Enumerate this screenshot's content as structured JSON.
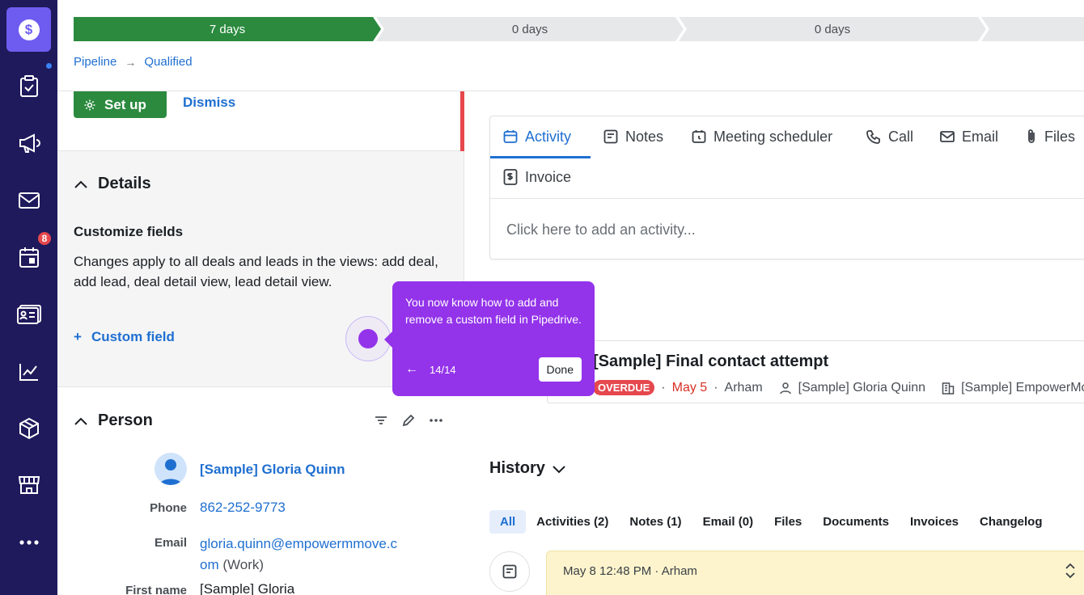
{
  "sidebar": {
    "logo_symbol": "$",
    "calendar_badge": "8",
    "items": [
      "tasks-icon",
      "megaphone-icon",
      "mail-icon",
      "calendar-icon",
      "contacts-icon",
      "chart-icon",
      "box-icon",
      "store-icon",
      "more-icon"
    ]
  },
  "stages": [
    "7 days",
    "0 days",
    "0 days"
  ],
  "breadcrumb": {
    "pipeline": "Pipeline",
    "arrow": "→",
    "stage": "Qualified"
  },
  "setup": {
    "setup_label": "Set up",
    "dismiss_label": "Dismiss"
  },
  "details": {
    "title": "Details",
    "customize_title": "Customize fields",
    "customize_text": "Changes apply to all deals and leads in the views: add deal, add lead, deal detail view, lead detail view.",
    "add_field": "Custom field",
    "plus": "+"
  },
  "person": {
    "title": "Person",
    "name": "[Sample] Gloria Quinn",
    "phone_label": "Phone",
    "phone": "862-252-9773",
    "email_label": "Email",
    "email_line1": "gloria.quinn@empowermmove.c",
    "email_line2": "om",
    "email_type": "(Work)",
    "first_name_label": "First name",
    "first_name": "[Sample] Gloria"
  },
  "tabs": {
    "activity": "Activity",
    "notes": "Notes",
    "meeting": "Meeting scheduler",
    "call": "Call",
    "email": "Email",
    "files": "Files",
    "invoice": "Invoice",
    "placeholder": "Click here to add an activity..."
  },
  "activity": {
    "title": "[Sample] Final contact attempt",
    "overdue": "OVERDUE",
    "date": "May 5",
    "owner": "Arham",
    "person": "[Sample] Gloria Quinn",
    "org": "[Sample] EmpowerMove",
    "sep": "·"
  },
  "history": {
    "title": "History",
    "tabs": [
      "All",
      "Activities (2)",
      "Notes (1)",
      "Email (0)",
      "Files",
      "Documents",
      "Invoices",
      "Changelog"
    ]
  },
  "note": {
    "meta": "May 8 12:48 PM · Arham"
  },
  "tooltip": {
    "text": "You now know how to add and remove a custom field in Pipedrive.",
    "back": "←",
    "counter": "14/14",
    "done": "Done"
  },
  "colors": {
    "sidebar": "#1f1a5c",
    "accent": "#1f6fd1",
    "success": "#2b8a3e",
    "tooltip": "#9333ea",
    "overdue": "#e5484d"
  }
}
